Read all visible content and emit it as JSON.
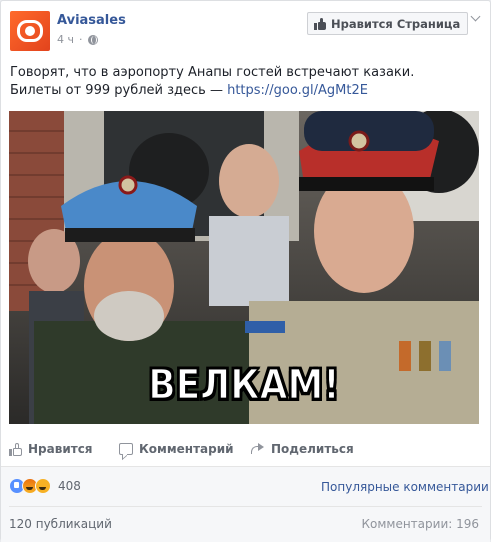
{
  "post": {
    "page_name": "Aviasales",
    "time": "4 ч",
    "like_page_button": "Нравится Страница",
    "text_line1": "Говорят, что в аэропорту Анапы гостей встречают казаки.",
    "text_line2_prefix": "Билеты от 999 рублей здесь — ",
    "link": "https://goo.gl/AgMt2E",
    "image_caption": "ВЕЛКАМ!"
  },
  "actions": {
    "like": "Нравится",
    "comment": "Комментарий",
    "share": "Поделиться"
  },
  "feedback": {
    "reaction_icons": [
      "like-icon",
      "angry-icon",
      "haha-icon"
    ],
    "reaction_count": "408",
    "sort_label": "Популярные комментарии",
    "shares": "120 публикаций",
    "comments": "Комментарии: 196"
  },
  "colors": {
    "brand_orange": "#ff6a2b",
    "link_blue": "#365899",
    "reaction_blue": "#5890ff"
  }
}
